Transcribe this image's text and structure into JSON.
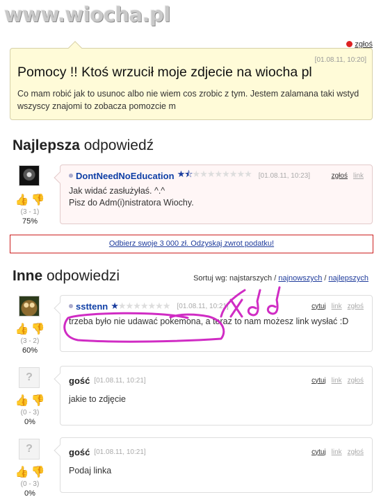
{
  "site": {
    "watermark": "www.wiocha.pl",
    "report_top": "zgłoś"
  },
  "question": {
    "date": "[01.08.11, 10:20]",
    "title": "Pomocy !! Ktoś wrzucił moje zdjecie na wiocha pl",
    "body": "Co mam robić jak to usunoc albo nie wiem cos zrobic z tym. Jestem zalamana taki wstyd wszyscy znajomi to zobacza pomozcie m"
  },
  "best": {
    "title_bold": "Najlepsza",
    "title_rest": " odpowiedź",
    "user": "DontNeedNoEducation",
    "date": "[01.08.11, 10:23]",
    "links": [
      "zgłoś",
      "link"
    ],
    "text": "Jak widać zasłużyłaś. ^.^\nPisz do Adm(i)nistratora Wiochy.",
    "votes": {
      "counts": "(3 - 1)",
      "pct": "75%"
    },
    "rating": 1.5
  },
  "ad": {
    "text": "Odbierz swoje 3 000 zł. Odzyskaj zwrot podatku!"
  },
  "others": {
    "title_bold": "Inne",
    "title_rest": " odpowiedzi",
    "sort": {
      "label": "Sortuj wg: najstarszych / ",
      "newest": "najnowszych",
      "sep": " / ",
      "best": "najlepszych"
    }
  },
  "answers": [
    {
      "user": "ssttenn",
      "date": "[01.08.11, 10:21]",
      "links": [
        "cytuj",
        "link",
        "zgłoś"
      ],
      "text": "trzeba było nie udawać pokemona, a teraz to nam możesz link wysłać :D",
      "votes": {
        "counts": "(3 - 2)",
        "pct": "60%"
      },
      "rating": 1.0
    },
    {
      "user": "gość",
      "date": "[01.08.11, 10:21]",
      "links": [
        "cytuj",
        "link",
        "zgłoś"
      ],
      "text": "jakie to zdjęcie",
      "votes": {
        "counts": "(0 - 3)",
        "pct": "0%"
      }
    },
    {
      "user": "gość",
      "date": "[01.08.11, 10:21]",
      "links": [
        "cytuj",
        "link",
        "zgłoś"
      ],
      "text": "Podaj linka",
      "votes": {
        "counts": "(0 - 3)",
        "pct": "0%"
      }
    }
  ],
  "guest_avatar_text": "?",
  "icons": [
    "thumb-up-icon",
    "thumb-down-icon",
    "star-icon",
    "report-icon"
  ],
  "colors": {
    "question_bg": "#fffbd8",
    "best_bg": "#fff6f6",
    "user_link": "#0f3fa6",
    "scribble": "#d02cc4",
    "ad_border": "#cc1e1e"
  },
  "annotation": {
    "text": "xdd"
  }
}
